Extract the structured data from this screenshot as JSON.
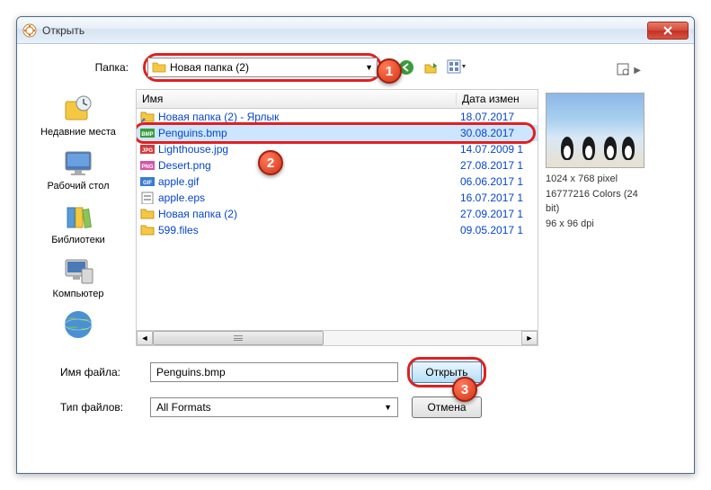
{
  "window": {
    "title": "Открыть"
  },
  "folder": {
    "label": "Папка:",
    "selected": "Новая папка (2)"
  },
  "sidebar": {
    "items": [
      {
        "label": "Недавние места"
      },
      {
        "label": "Рабочий стол"
      },
      {
        "label": "Библиотеки"
      },
      {
        "label": "Компьютер"
      },
      {
        "label": ""
      }
    ]
  },
  "list": {
    "col_name": "Имя",
    "col_date": "Дата измен",
    "rows": [
      {
        "name": "Новая папка (2) - Ярлык",
        "date": "18.07.2017",
        "type": "shortcut"
      },
      {
        "name": "Penguins.bmp",
        "date": "30.08.2017",
        "type": "bmp",
        "selected": true
      },
      {
        "name": "Lighthouse.jpg",
        "date": "14.07.2009 1",
        "type": "jpg"
      },
      {
        "name": "Desert.png",
        "date": "27.08.2017 1",
        "type": "png"
      },
      {
        "name": "apple.gif",
        "date": "06.06.2017 1",
        "type": "gif"
      },
      {
        "name": "apple.eps",
        "date": "16.07.2017 1",
        "type": "eps"
      },
      {
        "name": "Новая папка (2)",
        "date": "27.09.2017 1",
        "type": "folder"
      },
      {
        "name": "599.files",
        "date": "09.05.2017 1",
        "type": "folder"
      }
    ]
  },
  "preview": {
    "dims": "1024 x 768 pixel",
    "colors": "16777216 Colors (24 bit)",
    "dpi": "96 x 96 dpi"
  },
  "form": {
    "filename_label": "Имя файла:",
    "filename_value": "Penguins.bmp",
    "filetype_label": "Тип файлов:",
    "filetype_value": "All Formats",
    "open": "Открыть",
    "cancel": "Отмена"
  },
  "badges": {
    "b1": "1",
    "b2": "2",
    "b3": "3"
  }
}
